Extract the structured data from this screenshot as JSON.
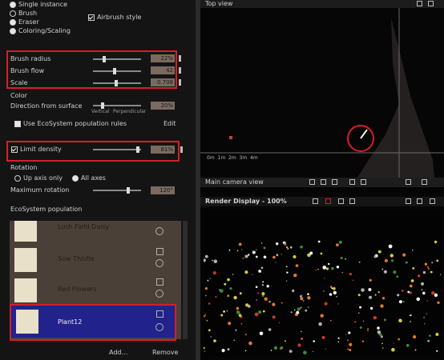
{
  "brush_mode": {
    "options": [
      "Single instance",
      "Brush",
      "Eraser",
      "Coloring/Scaling"
    ],
    "airbrush_label": "Airbrush style"
  },
  "params": [
    {
      "label": "Brush radius",
      "value": "22%",
      "level": 0.22
    },
    {
      "label": "Brush flow",
      "value": "42",
      "level": 0.42
    },
    {
      "label": "Scale",
      "value": "0.708",
      "level": 0.45
    }
  ],
  "color_section": {
    "title": "Color",
    "direction_label": "Direction from surface",
    "direction_value": "20%",
    "vertical_label": "Vertical",
    "perpendicular_label": "Perpendicular",
    "eco_rules_label": "Use EcoSystem population rules",
    "edit_label": "Edit"
  },
  "limit_density": {
    "label": "Limit density",
    "value": "81%",
    "level": 0.81
  },
  "rotation": {
    "title": "Rotation",
    "up_axis_label": "Up axis only",
    "all_axes_label": "All axes",
    "max_rotation_label": "Maximum rotation",
    "max_rotation_value": "120°",
    "level": 0.67
  },
  "population": {
    "title": "EcoSystem population",
    "items": [
      {
        "name": "Lush Field Daisy"
      },
      {
        "name": "Sow Thistle"
      },
      {
        "name": "Red Flowers"
      },
      {
        "name": "Plant12"
      }
    ],
    "add_label": "Add...",
    "remove_label": "Remove"
  },
  "top_view": {
    "title": "Top view",
    "scale_labels": [
      "0m",
      "1m",
      "2m",
      "3m",
      "4m"
    ]
  },
  "main_camera": {
    "title": "Main camera view"
  },
  "render": {
    "title": "Render Display - 100%"
  },
  "colors": {
    "highlight": "#d81d2a",
    "selection": "#22228c"
  }
}
